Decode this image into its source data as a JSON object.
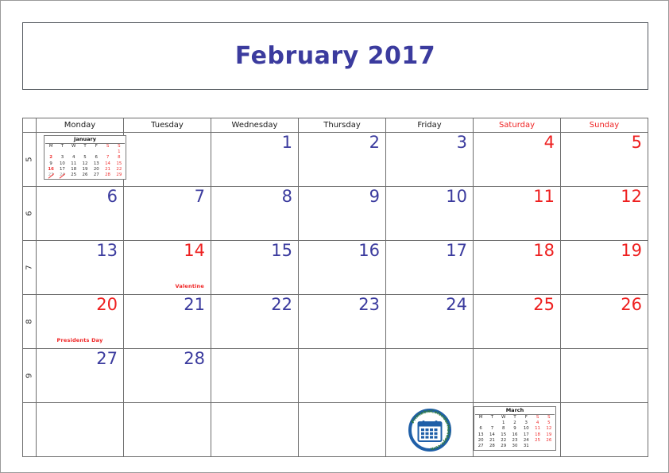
{
  "page": {
    "title": "February 2017",
    "accent_blue": "#3b3b9e",
    "accent_red": "#ee2020",
    "border_color": "#6d6d6d"
  },
  "calendar": {
    "day_headers": [
      {
        "label": "Monday",
        "weekend": false
      },
      {
        "label": "Tuesday",
        "weekend": false
      },
      {
        "label": "Wednesday",
        "weekend": false
      },
      {
        "label": "Thursday",
        "weekend": false
      },
      {
        "label": "Friday",
        "weekend": false
      },
      {
        "label": "Saturday",
        "weekend": true
      },
      {
        "label": "Sunday",
        "weekend": true
      }
    ],
    "week_numbers": [
      "5",
      "6",
      "7",
      "8",
      "9",
      ""
    ],
    "weeks": [
      {
        "week_number": "5",
        "days": [
          {
            "num": "",
            "kind": "mini-january",
            "holiday": ""
          },
          {
            "num": "",
            "kind": "empty",
            "holiday": ""
          },
          {
            "num": "1",
            "kind": "weekday",
            "holiday": ""
          },
          {
            "num": "2",
            "kind": "weekday",
            "holiday": ""
          },
          {
            "num": "3",
            "kind": "weekday",
            "holiday": ""
          },
          {
            "num": "4",
            "kind": "weekend",
            "holiday": ""
          },
          {
            "num": "5",
            "kind": "weekend",
            "holiday": ""
          }
        ]
      },
      {
        "week_number": "6",
        "days": [
          {
            "num": "6",
            "kind": "weekday",
            "holiday": ""
          },
          {
            "num": "7",
            "kind": "weekday",
            "holiday": ""
          },
          {
            "num": "8",
            "kind": "weekday",
            "holiday": ""
          },
          {
            "num": "9",
            "kind": "weekday",
            "holiday": ""
          },
          {
            "num": "10",
            "kind": "weekday",
            "holiday": ""
          },
          {
            "num": "11",
            "kind": "weekend",
            "holiday": ""
          },
          {
            "num": "12",
            "kind": "weekend",
            "holiday": ""
          }
        ]
      },
      {
        "week_number": "7",
        "days": [
          {
            "num": "13",
            "kind": "weekday",
            "holiday": ""
          },
          {
            "num": "14",
            "kind": "holiday",
            "holiday": "Valentine"
          },
          {
            "num": "15",
            "kind": "weekday",
            "holiday": ""
          },
          {
            "num": "16",
            "kind": "weekday",
            "holiday": ""
          },
          {
            "num": "17",
            "kind": "weekday",
            "holiday": ""
          },
          {
            "num": "18",
            "kind": "weekend",
            "holiday": ""
          },
          {
            "num": "19",
            "kind": "weekend",
            "holiday": ""
          }
        ]
      },
      {
        "week_number": "8",
        "days": [
          {
            "num": "20",
            "kind": "holiday",
            "holiday": "Presidents Day"
          },
          {
            "num": "21",
            "kind": "weekday",
            "holiday": ""
          },
          {
            "num": "22",
            "kind": "weekday",
            "holiday": ""
          },
          {
            "num": "23",
            "kind": "weekday",
            "holiday": ""
          },
          {
            "num": "24",
            "kind": "weekday",
            "holiday": ""
          },
          {
            "num": "25",
            "kind": "weekend",
            "holiday": ""
          },
          {
            "num": "26",
            "kind": "weekend",
            "holiday": ""
          }
        ]
      },
      {
        "week_number": "9",
        "days": [
          {
            "num": "27",
            "kind": "weekday",
            "holiday": ""
          },
          {
            "num": "28",
            "kind": "weekday",
            "holiday": ""
          },
          {
            "num": "",
            "kind": "empty",
            "holiday": ""
          },
          {
            "num": "",
            "kind": "empty",
            "holiday": ""
          },
          {
            "num": "",
            "kind": "empty",
            "holiday": ""
          },
          {
            "num": "",
            "kind": "empty",
            "holiday": ""
          },
          {
            "num": "",
            "kind": "empty",
            "holiday": ""
          }
        ]
      },
      {
        "week_number": "",
        "days": [
          {
            "num": "",
            "kind": "empty",
            "holiday": ""
          },
          {
            "num": "",
            "kind": "empty",
            "holiday": ""
          },
          {
            "num": "",
            "kind": "empty",
            "holiday": ""
          },
          {
            "num": "",
            "kind": "empty",
            "holiday": ""
          },
          {
            "num": "",
            "kind": "logo",
            "holiday": ""
          },
          {
            "num": "",
            "kind": "mini-march",
            "holiday": ""
          },
          {
            "num": "",
            "kind": "empty",
            "holiday": ""
          }
        ]
      }
    ]
  },
  "mini_january": {
    "title": "January",
    "headers": [
      "M",
      "T",
      "W",
      "T",
      "F",
      "S",
      "S"
    ],
    "rows": [
      [
        {
          "d": "",
          "c": ""
        },
        {
          "d": "",
          "c": ""
        },
        {
          "d": "",
          "c": ""
        },
        {
          "d": "",
          "c": ""
        },
        {
          "d": "",
          "c": ""
        },
        {
          "d": "",
          "c": ""
        },
        {
          "d": "1",
          "c": "we"
        }
      ],
      [
        {
          "d": "2",
          "c": "hol"
        },
        {
          "d": "3",
          "c": ""
        },
        {
          "d": "4",
          "c": ""
        },
        {
          "d": "5",
          "c": ""
        },
        {
          "d": "6",
          "c": ""
        },
        {
          "d": "7",
          "c": "we"
        },
        {
          "d": "8",
          "c": "we"
        }
      ],
      [
        {
          "d": "9",
          "c": ""
        },
        {
          "d": "10",
          "c": ""
        },
        {
          "d": "11",
          "c": ""
        },
        {
          "d": "12",
          "c": ""
        },
        {
          "d": "13",
          "c": ""
        },
        {
          "d": "14",
          "c": "we"
        },
        {
          "d": "15",
          "c": "we"
        }
      ],
      [
        {
          "d": "16",
          "c": "hol"
        },
        {
          "d": "17",
          "c": ""
        },
        {
          "d": "18",
          "c": ""
        },
        {
          "d": "19",
          "c": ""
        },
        {
          "d": "20",
          "c": ""
        },
        {
          "d": "21",
          "c": "we"
        },
        {
          "d": "22",
          "c": "we"
        }
      ],
      [
        {
          "d": "23",
          "c": "strike"
        },
        {
          "d": "24",
          "c": "strike"
        },
        {
          "d": "25",
          "c": ""
        },
        {
          "d": "26",
          "c": ""
        },
        {
          "d": "27",
          "c": ""
        },
        {
          "d": "28",
          "c": "we"
        },
        {
          "d": "29",
          "c": "we"
        }
      ]
    ]
  },
  "mini_march": {
    "title": "March",
    "headers": [
      "M",
      "T",
      "W",
      "T",
      "F",
      "S",
      "S"
    ],
    "rows": [
      [
        {
          "d": "",
          "c": ""
        },
        {
          "d": "",
          "c": ""
        },
        {
          "d": "1",
          "c": ""
        },
        {
          "d": "2",
          "c": ""
        },
        {
          "d": "3",
          "c": ""
        },
        {
          "d": "4",
          "c": "we"
        },
        {
          "d": "5",
          "c": "we"
        }
      ],
      [
        {
          "d": "6",
          "c": ""
        },
        {
          "d": "7",
          "c": ""
        },
        {
          "d": "8",
          "c": ""
        },
        {
          "d": "9",
          "c": ""
        },
        {
          "d": "10",
          "c": ""
        },
        {
          "d": "11",
          "c": "we"
        },
        {
          "d": "12",
          "c": "we"
        }
      ],
      [
        {
          "d": "13",
          "c": ""
        },
        {
          "d": "14",
          "c": ""
        },
        {
          "d": "15",
          "c": ""
        },
        {
          "d": "16",
          "c": ""
        },
        {
          "d": "17",
          "c": ""
        },
        {
          "d": "18",
          "c": "we"
        },
        {
          "d": "19",
          "c": "we"
        }
      ],
      [
        {
          "d": "20",
          "c": ""
        },
        {
          "d": "21",
          "c": ""
        },
        {
          "d": "22",
          "c": ""
        },
        {
          "d": "23",
          "c": ""
        },
        {
          "d": "24",
          "c": ""
        },
        {
          "d": "25",
          "c": "we"
        },
        {
          "d": "26",
          "c": "we"
        }
      ],
      [
        {
          "d": "27",
          "c": ""
        },
        {
          "d": "28",
          "c": ""
        },
        {
          "d": "29",
          "c": ""
        },
        {
          "d": "30",
          "c": ""
        },
        {
          "d": "31",
          "c": ""
        },
        {
          "d": "",
          "c": ""
        },
        {
          "d": "",
          "c": ""
        }
      ]
    ]
  },
  "logo": {
    "text": "PrintableCalendarHolidays.com",
    "icon": "calendar-badge-icon",
    "ring_color": "#1f5fa8",
    "text_color": "#2f7d32"
  }
}
